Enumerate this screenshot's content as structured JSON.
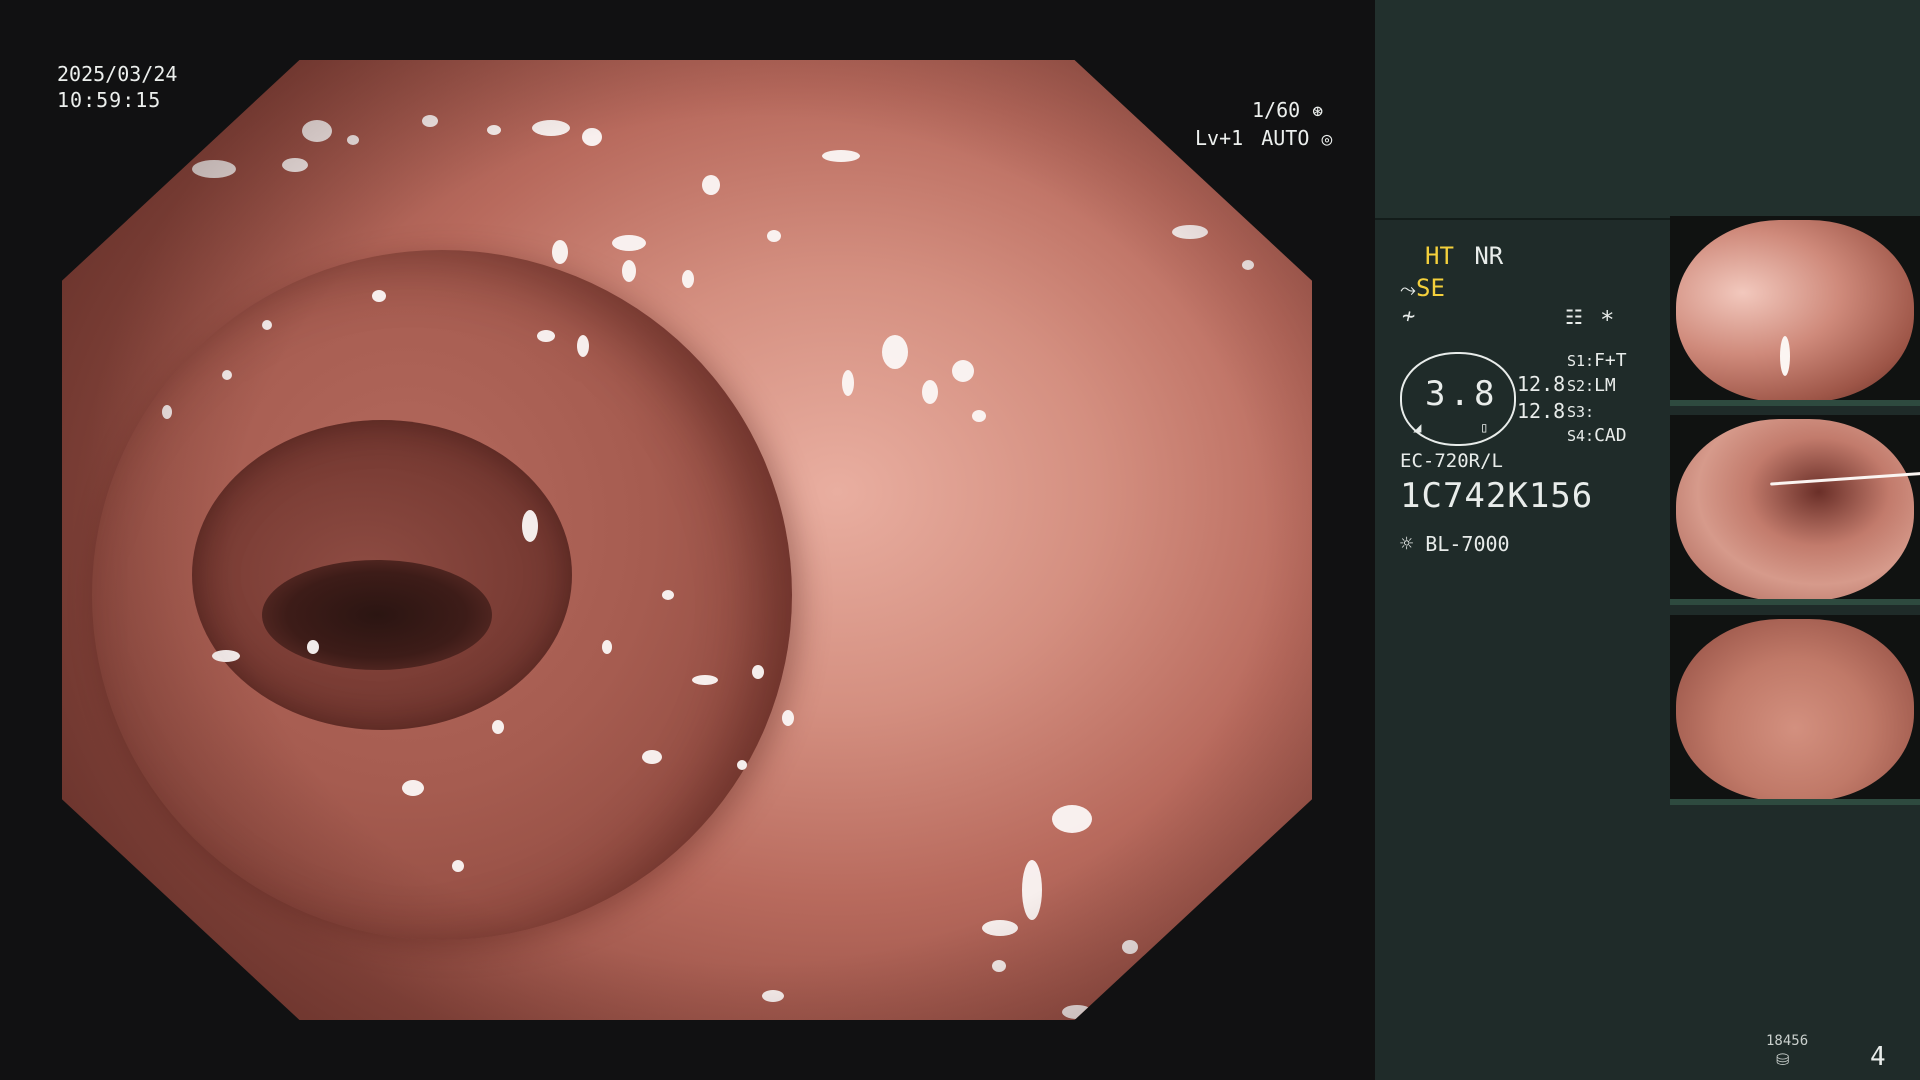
{
  "overlay": {
    "date": "2025/03/24",
    "time": "10:59:15",
    "shutter": "1/60",
    "level": "Lv+1",
    "mode": "AUTO"
  },
  "panel": {
    "ht": "HT",
    "nr": "NR",
    "se": "SE",
    "asterisk": "*",
    "brightness": "3.8",
    "val_1": "12.8",
    "val_2": "12.8",
    "switches": [
      {
        "key": "S1:",
        "value": "F+T"
      },
      {
        "key": "S2:",
        "value": "LM"
      },
      {
        "key": "S3:",
        "value": ""
      },
      {
        "key": "S4:",
        "value": "CAD"
      }
    ],
    "scope_model": "EC-720R/L",
    "serial": "1C742K156",
    "light_source": "BL-7000",
    "storage_count": "18456",
    "page_number": "4"
  },
  "icons": {
    "shutter_icon": "aperture-icon",
    "auto_icon": "target-icon",
    "light_icon": "sun-icon",
    "storage_icon": "database-icon"
  },
  "colors": {
    "panel_bg": "#1f2b29",
    "highlight": "#f4d03c",
    "text": "#e8ecea"
  }
}
